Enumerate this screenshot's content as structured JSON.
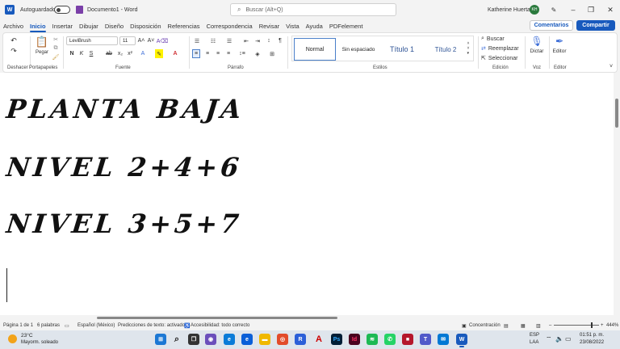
{
  "titlebar": {
    "logo_letter": "W",
    "autosave_label": "Autoguardado",
    "doc_title": "Documento1 - Word",
    "search_placeholder": "Buscar (Alt+Q)",
    "user_name": "Katherine Huerta",
    "user_initials": "KH",
    "minimize": "–",
    "restore": "❐",
    "close": "✕"
  },
  "tabs": [
    "Archivo",
    "Inicio",
    "Insertar",
    "Dibujar",
    "Diseño",
    "Disposición",
    "Referencias",
    "Correspondencia",
    "Revisar",
    "Vista",
    "Ayuda",
    "PDFelement"
  ],
  "active_tab": "Inicio",
  "buttons": {
    "comments": "Comentarios",
    "share": "Compartir"
  },
  "ribbon": {
    "undo_label": "Deshacer",
    "clipboard": {
      "paste": "Pegar",
      "label": "Portapapeles"
    },
    "font": {
      "name": "LeviBrush",
      "size": "11",
      "label": "Fuente",
      "bold": "N",
      "italic": "K",
      "underline": "S",
      "strike": "ab",
      "sub": "x₂",
      "sup": "x²"
    },
    "paragraph_label": "Párrafo",
    "styles": {
      "normal": "Normal",
      "no_spacing": "Sin espaciado",
      "title1": "Título 1",
      "title2": "Título 2",
      "label": "Estilos"
    },
    "editing": {
      "find": "Buscar",
      "replace": "Reemplazar",
      "select": "Seleccionar",
      "label": "Edición"
    },
    "voice": {
      "dictate": "Dictar",
      "label": "Voz"
    },
    "editor": {
      "button": "Editor",
      "label": "Editor"
    }
  },
  "document": {
    "lines": [
      "PLANTA BAJA",
      "NIVEL 2+4+6",
      "NIVEL 3+5+7"
    ]
  },
  "status": {
    "page": "Página 1 de 1",
    "words": "6 palabras",
    "language": "Español (México)",
    "text_predictions": "Predicciones de texto: activado",
    "accessibility": "Accesibilidad: todo correcto",
    "focus": "Concentración",
    "zoom": "444%"
  },
  "taskbar": {
    "temperature": "23°C",
    "weather": "Mayorm. soleado",
    "lang_top": "ESP",
    "lang_bottom": "LAA",
    "time": "01:51 p. m.",
    "date": "23/08/2022"
  },
  "colors": {
    "accent": "#185abd",
    "avatar": "#2b7a3d"
  }
}
